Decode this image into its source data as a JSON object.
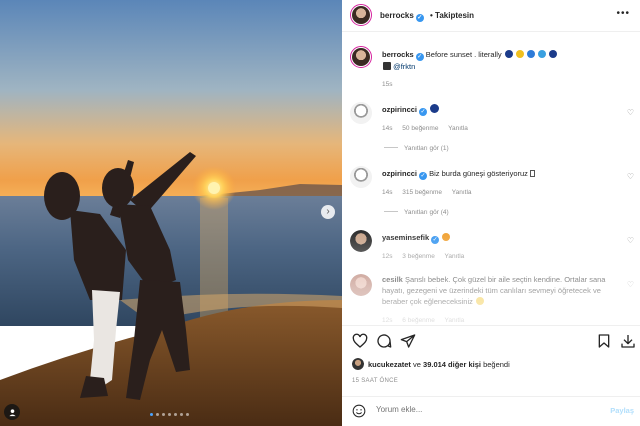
{
  "post": {
    "username": "berrocks",
    "follow_label": "Takiptesin",
    "more_icon": "more-horizontal-icon",
    "caption_user": "berrocks",
    "caption_text": "Before sunset . literally",
    "caption_credit": "@frktn",
    "caption_time": "15s",
    "likes_user": "kucukezatet",
    "likes_mid": " ve ",
    "likes_count": "39.014 diğer kişi",
    "likes_suffix": " beğendi",
    "timestamp": "15 SAAT ÖNCE",
    "add_comment_placeholder": "Yorum ekle...",
    "post_button": "Paylaş",
    "carousel_count": 7,
    "carousel_active": 0
  },
  "comments": [
    {
      "user": "ozpirincci",
      "text": "",
      "time": "14s",
      "likes": "50 beğenme",
      "reply": "Yanıtla",
      "view_replies": "Yanıtları gör (1)"
    },
    {
      "user": "ozpirincci",
      "text": "Biz burda güneşi gösteriyoruz",
      "time": "14s",
      "likes": "315 beğenme",
      "reply": "Yanıtla",
      "view_replies": "Yanıtları gör (4)"
    },
    {
      "user": "yaseminsefik",
      "text": "",
      "time": "12s",
      "likes": "3 beğenme",
      "reply": "Yanıtla"
    },
    {
      "user": "cesilk",
      "text": "Şanslı bebek. Çok güzel bir aile seçtin kendine. Ortalar sana hayatı, gezegeni ve üzerindeki tüm canlıları sevmeyi öğretecek ve beraber çok eğleneceksiniz",
      "time": "12s",
      "likes": "6 beğenme",
      "reply": "Yanıtla"
    }
  ],
  "colors": {
    "accent": "#3897f0",
    "link": "#00376b",
    "muted": "#8e8e8e"
  }
}
